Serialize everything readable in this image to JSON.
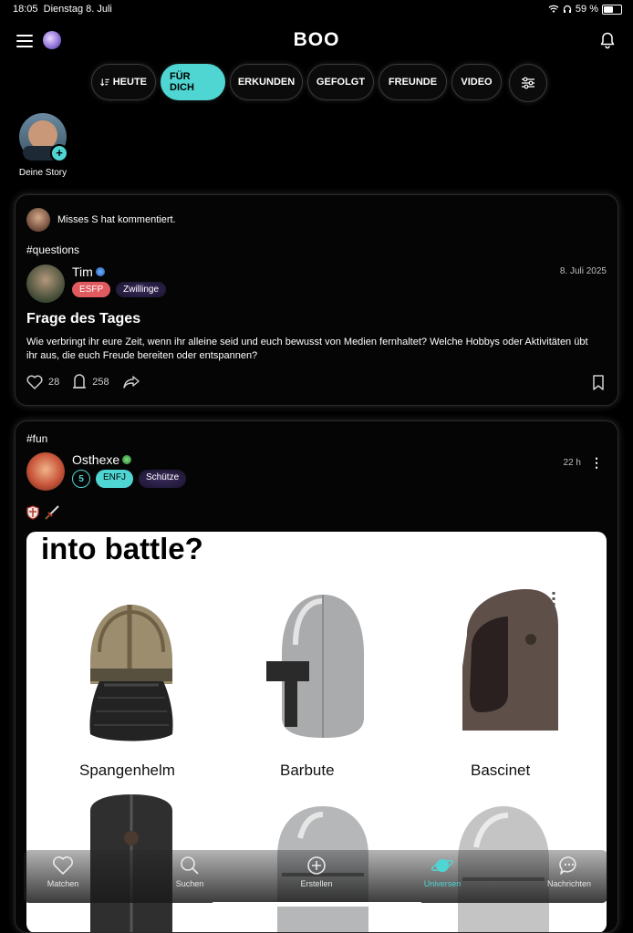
{
  "status": {
    "time": "18:05",
    "date": "Dienstag 8. Juli",
    "battery": "59 %",
    "battery_level": 0.59
  },
  "header": {
    "brand": "BOO"
  },
  "tabs": [
    {
      "label": "HEUTE"
    },
    {
      "label": "FÜR DICH"
    },
    {
      "label": "ERKUNDEN"
    },
    {
      "label": "GEFOLGT"
    },
    {
      "label": "FREUNDE"
    },
    {
      "label": "VIDEO"
    }
  ],
  "story": {
    "label": "Deine Story",
    "plus": "+"
  },
  "post1": {
    "activity": "Misses S hat kommentiert.",
    "hashtag": "#questions",
    "author": "Tim",
    "type_badge": "ESFP",
    "zodiac_badge": "Zwillinge",
    "date": "8. Juli 2025",
    "title": "Frage des Tages",
    "body": "Wie verbringt ihr eure Zeit, wenn ihr alleine seid und euch bewusst von Medien fernhaltet? Welche Hobbys oder Aktivitäten übt ihr aus, die euch Freude bereiten oder entspannen?",
    "likes": "28",
    "comments": "258"
  },
  "post2": {
    "hashtag": "#fun",
    "author": "Osthexe",
    "level_badge": "5",
    "type_badge": "ENFJ",
    "zodiac_badge": "Schütze",
    "time": "22 h",
    "more": "⋮",
    "meme": {
      "title": "into battle?",
      "captions": [
        "Spangenhelm",
        "Barbute",
        "Bascinet"
      ]
    }
  },
  "nav": [
    {
      "label": "Matchen",
      "icon": "heart-icon"
    },
    {
      "label": "Suchen",
      "icon": "search-icon"
    },
    {
      "label": "Erstellen",
      "icon": "plus-circle-icon"
    },
    {
      "label": "Universen",
      "icon": "planet-icon"
    },
    {
      "label": "Nachrichten",
      "icon": "chat-bubble-icon"
    }
  ],
  "colors": {
    "accent": "#4fd6d3",
    "esfp": "#e05a5f",
    "background": "#000000"
  }
}
